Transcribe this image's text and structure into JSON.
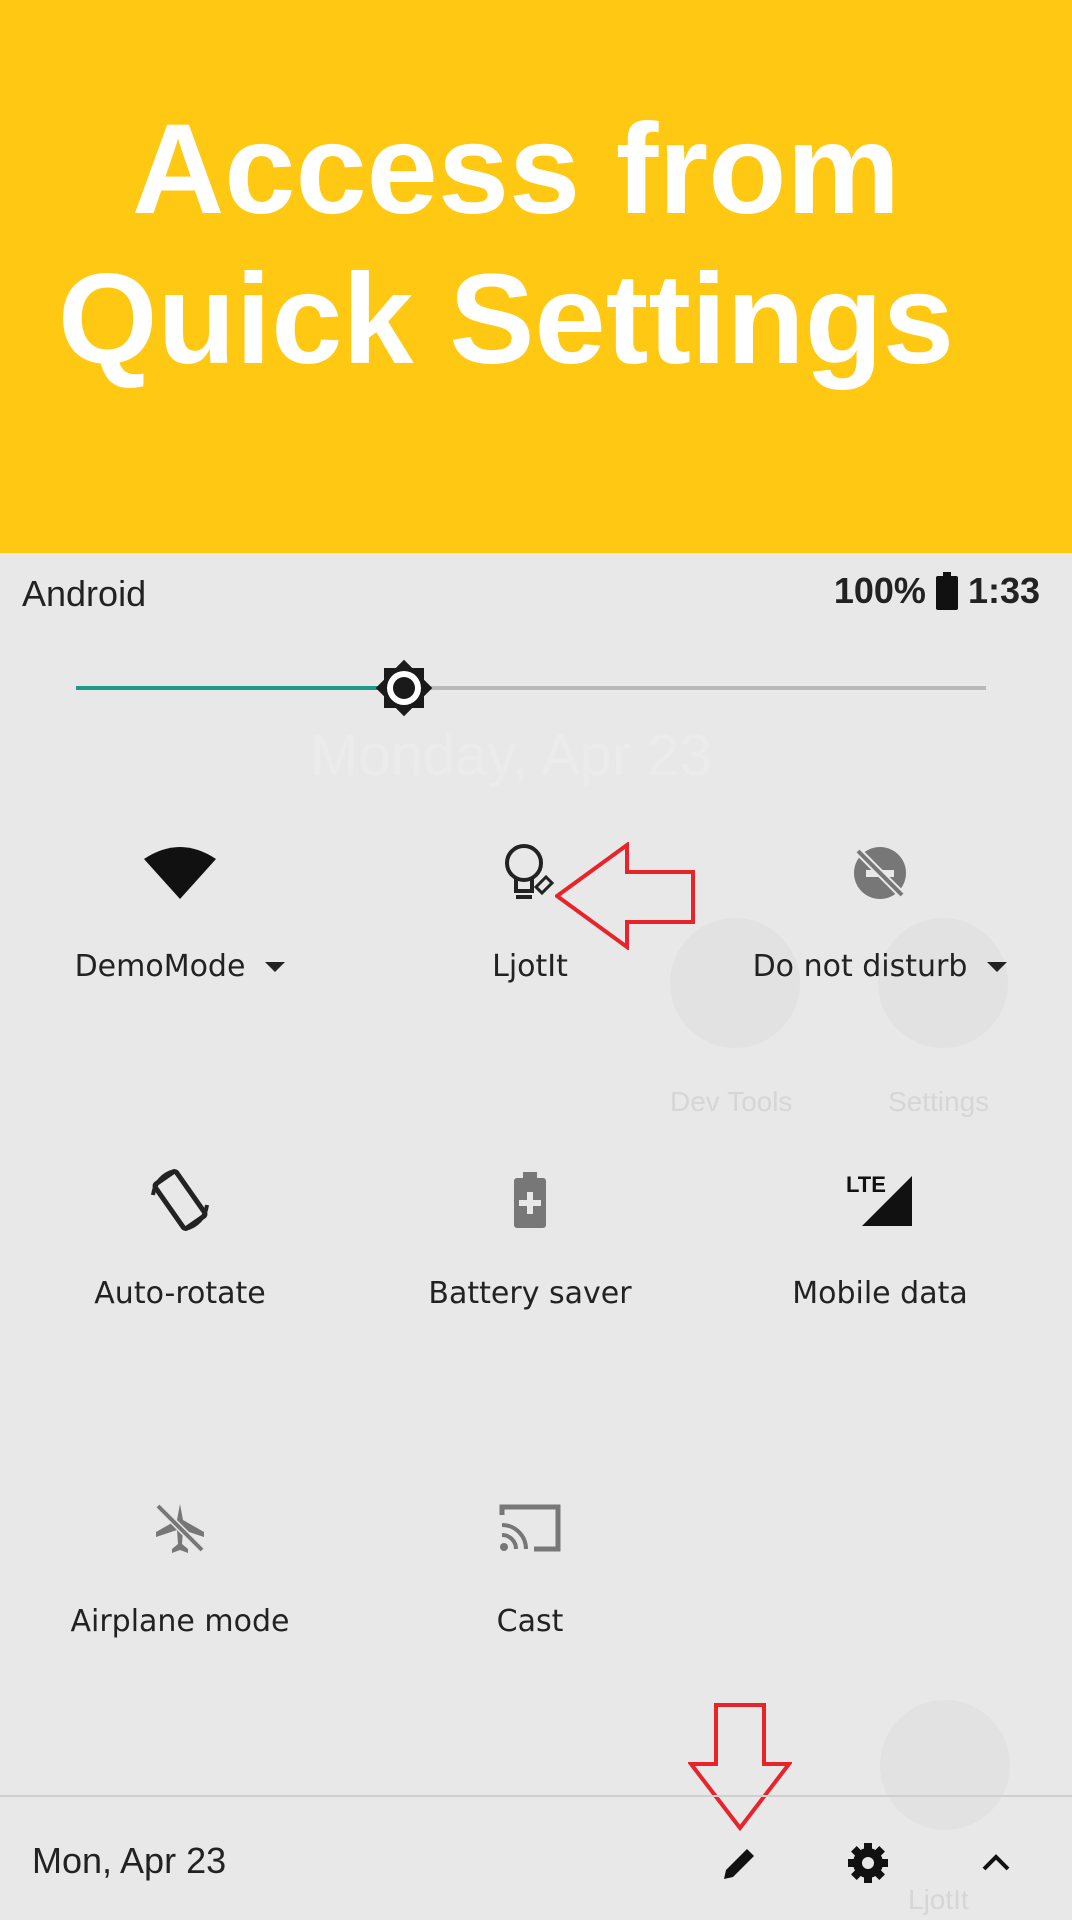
{
  "banner": {
    "line1": "Access from",
    "line2": "Quick Settings"
  },
  "status_bar": {
    "carrier": "Android",
    "battery_percent": "100%",
    "time": "1:33"
  },
  "brightness": {
    "level": 0.36
  },
  "background_ghost": {
    "date": "Monday, Apr 23",
    "apps": [
      "Dev Tools",
      "Settings",
      "LjotIt"
    ]
  },
  "tiles": [
    {
      "label": "DemoMode",
      "icon": "wifi-icon",
      "has_dropdown": true
    },
    {
      "label": "LjotIt",
      "icon": "ljotit-bulb-icon",
      "has_dropdown": false
    },
    {
      "label": "Do not disturb",
      "icon": "do-not-disturb-icon",
      "has_dropdown": true
    },
    {
      "label": "Auto-rotate",
      "icon": "auto-rotate-icon",
      "has_dropdown": false
    },
    {
      "label": "Battery saver",
      "icon": "battery-saver-icon",
      "has_dropdown": false
    },
    {
      "label": "Mobile data",
      "icon": "lte-signal-icon",
      "has_dropdown": false
    },
    {
      "label": "Airplane mode",
      "icon": "airplane-icon",
      "has_dropdown": false
    },
    {
      "label": "Cast",
      "icon": "cast-icon",
      "has_dropdown": false
    }
  ],
  "footer": {
    "date": "Mon, Apr 23",
    "edit_icon": "pencil-icon",
    "settings_icon": "gear-icon",
    "collapse_icon": "chevron-up-icon"
  },
  "colors": {
    "banner": "#fec813",
    "accent": "#1e9a87",
    "annotation_arrow": "#e8232a"
  }
}
